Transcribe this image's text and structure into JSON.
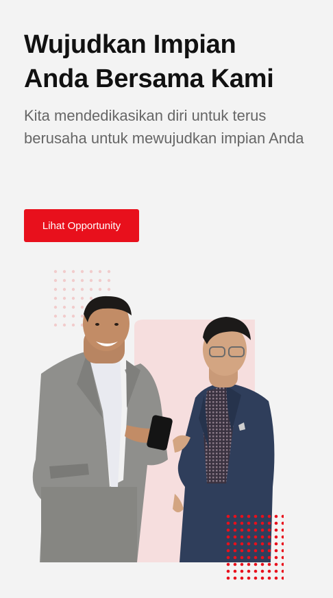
{
  "hero": {
    "title_line1": "Wujudkan Impian",
    "title_line2": "Anda Bersama Kami",
    "subtitle": "Kita mendedikasikan diri untuk terus berusaha untuk mewujudkan impian Anda"
  },
  "cta": {
    "label": "Lihat Opportunity"
  },
  "colors": {
    "accent": "#e8101c",
    "background": "#f3f3f3",
    "panel": "#f6dede",
    "dots_light": "#f1cccc",
    "text_dark": "#111111",
    "text_muted": "#666666"
  }
}
